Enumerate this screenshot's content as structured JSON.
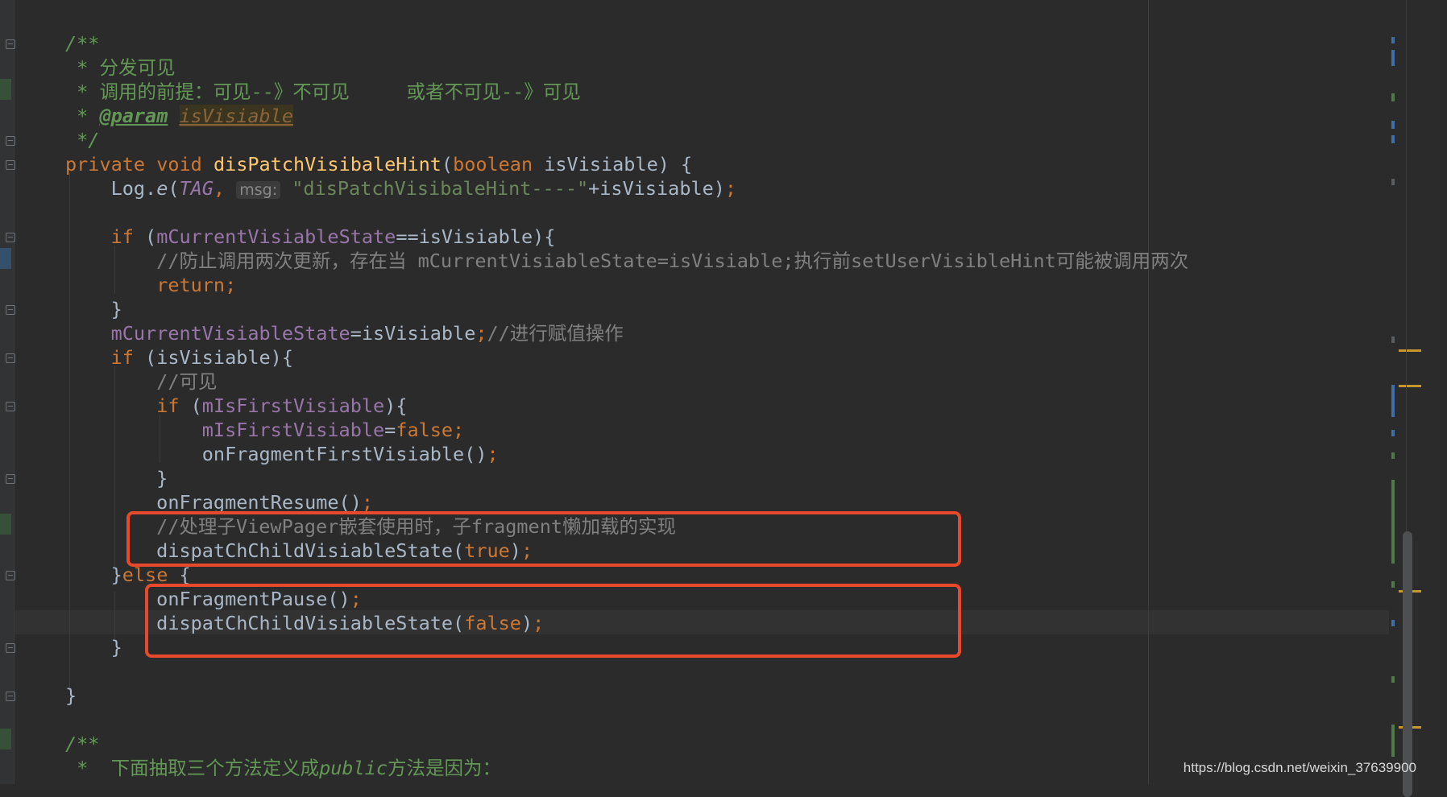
{
  "editor": {
    "lines": [
      [
        {
          "t": "/**",
          "c": "doc"
        }
      ],
      [
        {
          "t": " * ",
          "c": "doc"
        },
        {
          "t": "分发可见",
          "c": "doccn"
        }
      ],
      [
        {
          "t": " * ",
          "c": "doc"
        },
        {
          "t": "调用的前提：可见--》不可见     或者不可见--》可见",
          "c": "doccn"
        }
      ],
      [
        {
          "t": " * ",
          "c": "doc"
        },
        {
          "t": "@param",
          "c": "doctag"
        },
        {
          "t": " ",
          "c": "doc"
        },
        {
          "t": "isVisiable",
          "c": "docparam"
        }
      ],
      [
        {
          "t": " */",
          "c": "doc"
        }
      ],
      [
        {
          "t": "private ",
          "c": "kw"
        },
        {
          "t": "void ",
          "c": "kw"
        },
        {
          "t": "disPatchVisibaleHint",
          "c": "fn"
        },
        {
          "t": "(",
          "c": ""
        },
        {
          "t": "boolean ",
          "c": "kw"
        },
        {
          "t": "isVisiable) {",
          "c": ""
        }
      ],
      [
        {
          "t": "    Log.",
          "c": ""
        },
        {
          "t": "e",
          "c": "ital"
        },
        {
          "t": "(",
          "c": ""
        },
        {
          "t": "TAG",
          "c": "cst"
        },
        {
          "t": ", ",
          "c": "kw"
        },
        {
          "t": "msg:",
          "c": "hint"
        },
        {
          "t": " ",
          "c": ""
        },
        {
          "t": "\"disPatchVisibaleHint----\"",
          "c": "str"
        },
        {
          "t": "+isVisiable)",
          "c": ""
        },
        {
          "t": ";",
          "c": "kw"
        }
      ],
      [],
      [
        {
          "t": "    ",
          "c": ""
        },
        {
          "t": "if ",
          "c": "kw"
        },
        {
          "t": "(",
          "c": ""
        },
        {
          "t": "mCurrentVisiableState",
          "c": "field"
        },
        {
          "t": "==isVisiable){",
          "c": ""
        }
      ],
      [
        {
          "t": "        //防止调用两次更新，存在当 mCurrentVisiableState=isVisiable;执行前setUserVisibleHint可能被调用两次",
          "c": "cmt"
        }
      ],
      [
        {
          "t": "        ",
          "c": ""
        },
        {
          "t": "return;",
          "c": "kw"
        }
      ],
      [
        {
          "t": "    }",
          "c": ""
        }
      ],
      [
        {
          "t": "    ",
          "c": ""
        },
        {
          "t": "mCurrentVisiableState",
          "c": "field"
        },
        {
          "t": "=isVisiable",
          "c": ""
        },
        {
          "t": ";",
          "c": "kw"
        },
        {
          "t": "//进行赋值操作",
          "c": "cmt"
        }
      ],
      [
        {
          "t": "    ",
          "c": ""
        },
        {
          "t": "if ",
          "c": "kw"
        },
        {
          "t": "(isVisiable){",
          "c": ""
        }
      ],
      [
        {
          "t": "        //可见",
          "c": "cmt"
        }
      ],
      [
        {
          "t": "        ",
          "c": ""
        },
        {
          "t": "if ",
          "c": "kw"
        },
        {
          "t": "(",
          "c": ""
        },
        {
          "t": "mIsFirstVisiable",
          "c": "field"
        },
        {
          "t": "){",
          "c": ""
        }
      ],
      [
        {
          "t": "            ",
          "c": ""
        },
        {
          "t": "mIsFirstVisiable",
          "c": "field"
        },
        {
          "t": "=",
          "c": ""
        },
        {
          "t": "false;",
          "c": "kw"
        }
      ],
      [
        {
          "t": "            onFragmentFirstVisiable()",
          "c": ""
        },
        {
          "t": ";",
          "c": "kw"
        }
      ],
      [
        {
          "t": "        }",
          "c": ""
        }
      ],
      [
        {
          "t": "        onFragmentResume()",
          "c": ""
        },
        {
          "t": ";",
          "c": "kw"
        }
      ],
      [
        {
          "t": "        //处理子ViewPager嵌套使用时，子fragment懒加载的实现",
          "c": "cmt"
        }
      ],
      [
        {
          "t": "        dispatChChildVisiableState(",
          "c": ""
        },
        {
          "t": "true",
          "c": "kw"
        },
        {
          "t": ")",
          "c": ""
        },
        {
          "t": ";",
          "c": "kw"
        }
      ],
      [
        {
          "t": "    }",
          "c": ""
        },
        {
          "t": "else ",
          "c": "kw"
        },
        {
          "t": "{",
          "c": ""
        }
      ],
      [
        {
          "t": "        onFragmentPause()",
          "c": ""
        },
        {
          "t": ";",
          "c": "kw"
        }
      ],
      [
        {
          "t": "        dispatChChildVisiableState(",
          "c": ""
        },
        {
          "t": "false",
          "c": "kw"
        },
        {
          "t": ")",
          "c": ""
        },
        {
          "t": ";",
          "c": "kw"
        }
      ],
      [
        {
          "t": "    }",
          "c": ""
        }
      ],
      [],
      [
        {
          "t": "}",
          "c": ""
        }
      ],
      [],
      [
        {
          "t": "/**",
          "c": "doc"
        }
      ],
      [
        {
          "t": " *  ",
          "c": "doc"
        },
        {
          "t": "下面抽取三个方法定义成",
          "c": "doccn"
        },
        {
          "t": "public",
          "c": "doc"
        },
        {
          "t": "方法是因为：",
          "c": "doccn"
        }
      ]
    ]
  },
  "watermark": "https://blog.csdn.net/weixin_37639900"
}
